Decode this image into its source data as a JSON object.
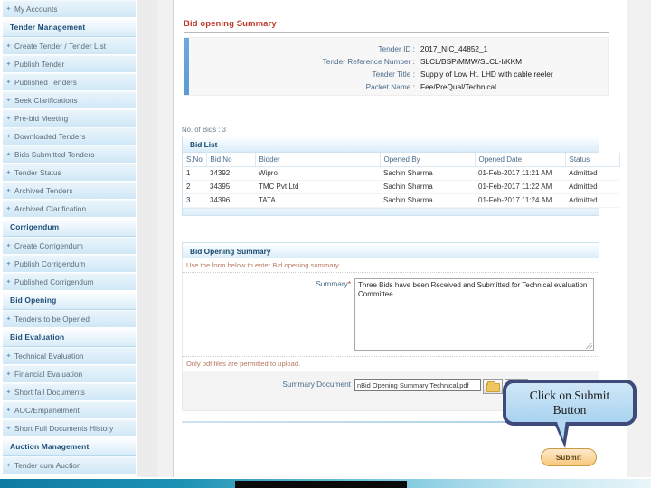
{
  "sidebar": {
    "items": [
      {
        "type": "link",
        "label": "My Accounts"
      },
      {
        "type": "group",
        "label": "Tender Management"
      },
      {
        "type": "link",
        "label": "Create Tender / Tender List"
      },
      {
        "type": "link",
        "label": "Publish Tender"
      },
      {
        "type": "link",
        "label": "Published Tenders"
      },
      {
        "type": "link",
        "label": "Seek Clarifications"
      },
      {
        "type": "link",
        "label": "Pre-bid Meeting"
      },
      {
        "type": "link",
        "label": "Downloaded Tenders"
      },
      {
        "type": "link",
        "label": "Bids Submitted Tenders"
      },
      {
        "type": "link",
        "label": "Tender Status"
      },
      {
        "type": "link",
        "label": "Archived Tenders"
      },
      {
        "type": "link",
        "label": "Archived Clarification"
      },
      {
        "type": "group",
        "label": "Corrigendum"
      },
      {
        "type": "link",
        "label": "Create Corrigendum"
      },
      {
        "type": "link",
        "label": "Publish Corrigendum"
      },
      {
        "type": "link",
        "label": "Published Corrigendum"
      },
      {
        "type": "group",
        "label": "Bid Opening"
      },
      {
        "type": "link",
        "label": "Tenders to be Opened"
      },
      {
        "type": "group",
        "label": "Bid Evaluation"
      },
      {
        "type": "link",
        "label": "Technical Evaluation"
      },
      {
        "type": "link",
        "label": "Financial Evaluation"
      },
      {
        "type": "link",
        "label": "Short fall Documents"
      },
      {
        "type": "link",
        "label": "AOC/Empanelment"
      },
      {
        "type": "link",
        "label": "Short Full Documents History"
      },
      {
        "type": "group",
        "label": "Auction Management"
      },
      {
        "type": "link",
        "label": "Tender cum Auction"
      }
    ],
    "bullet_glyph": "✦"
  },
  "main": {
    "page_title": "Bid opening Summary",
    "tender_details": [
      {
        "label": "Tender ID :",
        "value": "2017_NIC_44852_1"
      },
      {
        "label": "Tender Reference Number :",
        "value": "SLCL/BSP/MMW/SLCL-I/KKM"
      },
      {
        "label": "Tender Title :",
        "value": "Supply of Low Ht. LHD with cable reeler"
      },
      {
        "label": "Packet Name :",
        "value": "Fee/PreQual/Technical"
      }
    ],
    "bid_count_text": "No. of Bids : 3",
    "bid_list": {
      "title": "Bid List",
      "columns": [
        "S.No",
        "Bid No",
        "Bidder",
        "Opened By",
        "Opened Date",
        "Status"
      ],
      "rows": [
        [
          "1",
          "34392",
          "Wipro",
          "Sachin Sharma",
          "01-Feb-2017 11:21 AM",
          "Admitted"
        ],
        [
          "2",
          "34395",
          "TMC Pvt Ltd",
          "Sachin Sharma",
          "01-Feb-2017 11:22 AM",
          "Admitted"
        ],
        [
          "3",
          "34396",
          "TATA",
          "Sachin Sharma",
          "01-Feb-2017 11:24 AM",
          "Admitted"
        ]
      ]
    },
    "bid_opening_summary": {
      "title": "Bid Opening Summary",
      "note": "Use the form below to enter Bid opening summary",
      "summary_label": "Summary",
      "required_mark": "*",
      "summary_value": "Three Bids have been Received and Submitted for Technical evaluation Committee",
      "upload_note": "Only pdf files are permitted to upload.",
      "document_label": "Summary Document",
      "file_value": "nBid Opening Summary Technical.pdf",
      "browse_icon": "folder-open-icon",
      "upload_icon": "upload-icon"
    },
    "submit_label": "Submit"
  },
  "callout": {
    "line1": "Click on Submit",
    "line2": "Button"
  },
  "colors": {
    "accent_red": "#c0392b",
    "header_blue": "#17496f",
    "label_blue": "#4a6b8a",
    "sidebar_item": "#dceef9",
    "callout_border": "#3d4a7a",
    "callout_fill": "#a9d3ef",
    "submit_button": "#f7c877",
    "bottom_bar": "#1d92b4"
  }
}
